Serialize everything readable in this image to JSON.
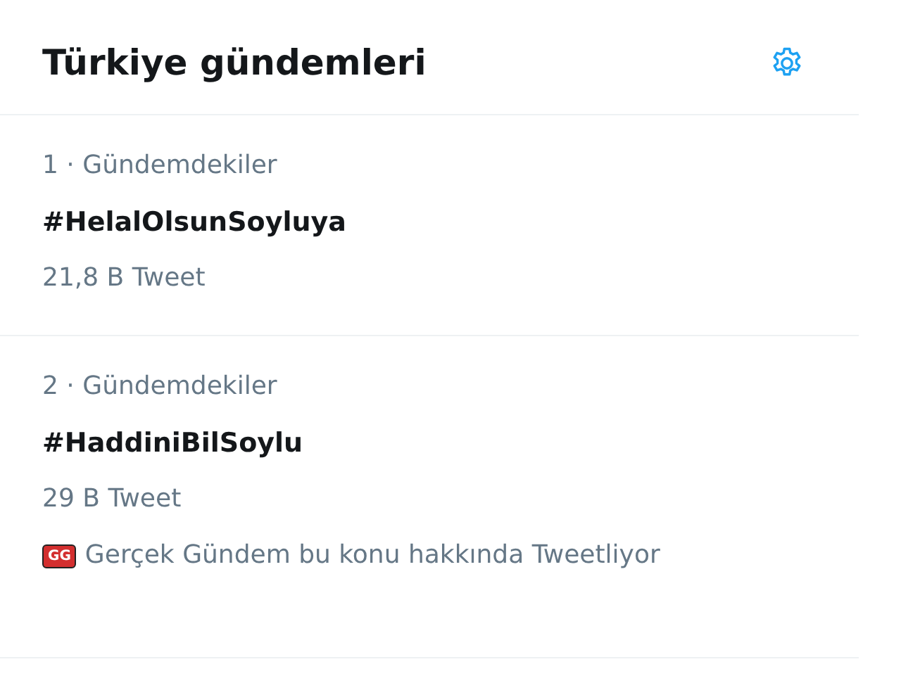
{
  "header": {
    "title": "Türkiye gündemleri"
  },
  "trends": [
    {
      "meta": "1 · Gündemdekiler",
      "name": "#HelalOlsunSoyluya",
      "count": "21,8 B Tweet"
    },
    {
      "meta": "2 · Gündemdekiler",
      "name": "#HaddiniBilSoylu",
      "count": "29 B Tweet",
      "context": {
        "avatar_text": "GG",
        "text": "Gerçek Gündem bu konu hakkında Tweetliyor"
      }
    }
  ]
}
